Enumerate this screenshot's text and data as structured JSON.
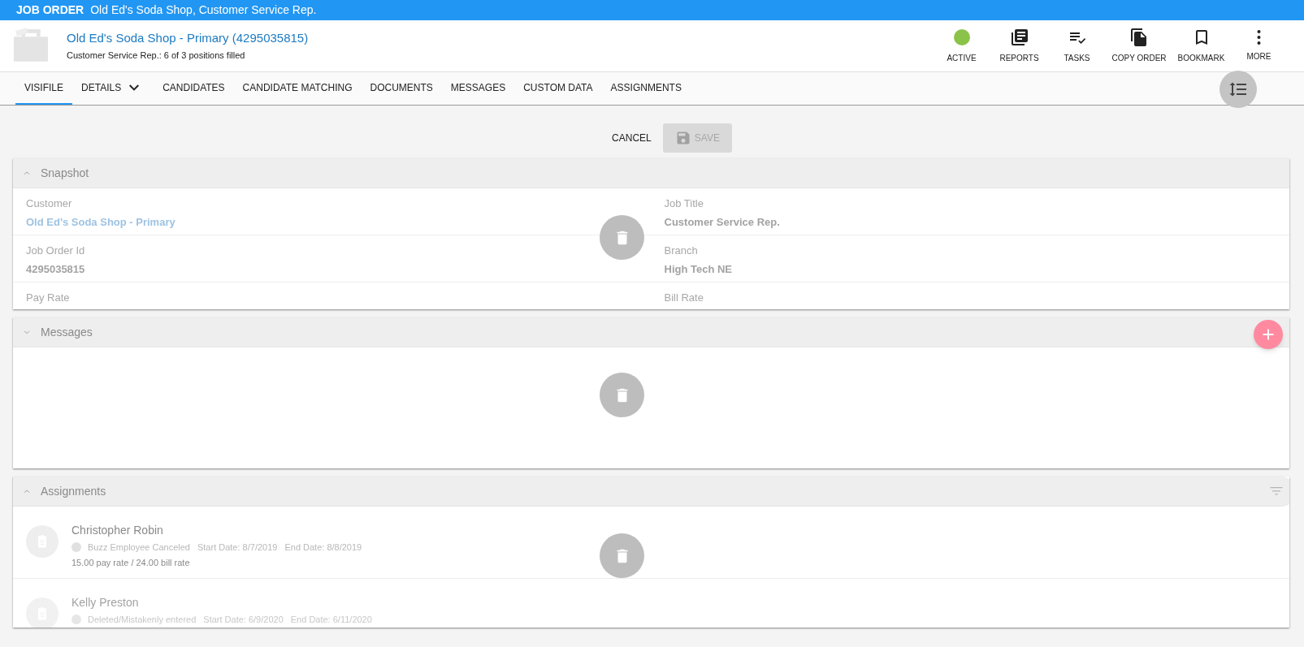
{
  "title_bar": {
    "label": "JOB ORDER",
    "title": "Old Ed's Soda Shop, Customer Service Rep."
  },
  "header": {
    "title": "Old Ed's Soda Shop - Primary (4295035815)",
    "subtitle": "Customer Service Rep.: 6 of 3 positions filled"
  },
  "toolbar": [
    {
      "kind": "status",
      "label": "ACTIVE",
      "color": "#8bc34a"
    },
    {
      "kind": "reports",
      "label": "REPORTS"
    },
    {
      "kind": "tasks",
      "label": "TASKS"
    },
    {
      "kind": "copy",
      "label": "COPY ORDER"
    },
    {
      "kind": "bookmark",
      "label": "BOOKMARK"
    },
    {
      "kind": "more",
      "label": "MORE"
    }
  ],
  "tabs": [
    {
      "label": "VISIFILE",
      "selected": true,
      "dropdown": false
    },
    {
      "label": "DETAILS",
      "selected": false,
      "dropdown": true
    },
    {
      "label": "CANDIDATES",
      "selected": false,
      "dropdown": false
    },
    {
      "label": "CANDIDATE MATCHING",
      "selected": false,
      "dropdown": false
    },
    {
      "label": "DOCUMENTS",
      "selected": false,
      "dropdown": false
    },
    {
      "label": "MESSAGES",
      "selected": false,
      "dropdown": false
    },
    {
      "label": "CUSTOM DATA",
      "selected": false,
      "dropdown": false
    },
    {
      "label": "ASSIGNMENTS",
      "selected": false,
      "dropdown": false
    }
  ],
  "actions": {
    "cancel": "CANCEL",
    "save": "SAVE",
    "save_disabled": true
  },
  "snapshot": {
    "title": "Snapshot",
    "expanded": true,
    "fields": [
      {
        "label": "Customer",
        "value": "Old Ed's Soda Shop - Primary",
        "kind": "link"
      },
      {
        "label": "Job Title",
        "value": "Customer Service Rep.",
        "kind": "text"
      },
      {
        "label": "Job Order Id",
        "value": "4295035815",
        "kind": "text"
      },
      {
        "label": "Branch",
        "value": "High Tech NE",
        "kind": "text"
      },
      {
        "label": "Pay Rate"
      },
      {
        "label": "Bill Rate"
      }
    ]
  },
  "messages": {
    "title": "Messages",
    "expanded": false
  },
  "assignments": {
    "title": "Assignments",
    "expanded": true,
    "rows": [
      {
        "name": "Christopher Robin",
        "status": "Buzz Employee Canceled",
        "start": "Start Date: 8/7/2019",
        "end": "End Date: 8/8/2019",
        "rates": "15.00 pay rate / 24.00 bill rate",
        "faded": false
      },
      {
        "name": "Kelly Preston",
        "status": "Deleted/Mistakenly entered",
        "start": "Start Date: 6/9/2020",
        "end": "End Date: 6/11/2020",
        "faded": true
      }
    ]
  }
}
